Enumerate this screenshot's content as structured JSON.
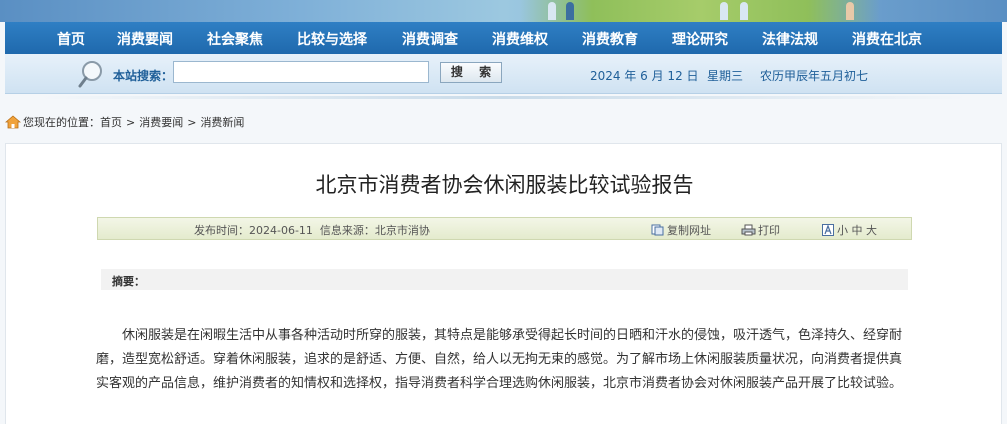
{
  "nav": {
    "items": [
      "首页",
      "消费要闻",
      "社会聚焦",
      "比较与选择",
      "消费调查",
      "消费维权",
      "消费教育",
      "理论研究",
      "法律法规",
      "消费在北京"
    ]
  },
  "search": {
    "label": "本站搜索：",
    "value": "",
    "placeholder": "",
    "button_label": "搜 索"
  },
  "date": {
    "gregorian": "2024 年 6 月 12 日",
    "weekday": "星期三",
    "lunar": "农历甲辰年五月初七"
  },
  "breadcrumb": {
    "prefix": "您现在的位置：",
    "items": [
      "首页",
      "消费要闻",
      "消费新闻"
    ],
    "separator": ">"
  },
  "article": {
    "title": "北京市消费者协会休闲服装比较试验报告",
    "meta": "发布时间：2024-06-11  信息来源：北京市消协",
    "copy_url_label": "复制网址",
    "print_label": "打印",
    "font_size_label": "小 中 大",
    "summary_label": "摘要：",
    "body": "休闲服装是在闲暇生活中从事各种活动时所穿的服装，其特点是能够承受得起长时间的日晒和汗水的侵蚀，吸汗透气，色泽持久、经穿耐磨，造型宽松舒适。穿着休闲服装，追求的是舒适、方便、自然，给人以无拘无束的感觉。为了解市场上休闲服装质量状况，向消费者提供真实客观的产品信息，维护消费者的知情权和选择权，指导消费者科学合理选购休闲服装，北京市消费者协会对休闲服装产品开展了比较试验。"
  },
  "colors": {
    "nav_bg": "#2f7fc4",
    "search_bar_bg": "#dbe9f5",
    "accent_text": "#1f5f99",
    "info_bar_bg": "#ebf0d9"
  }
}
